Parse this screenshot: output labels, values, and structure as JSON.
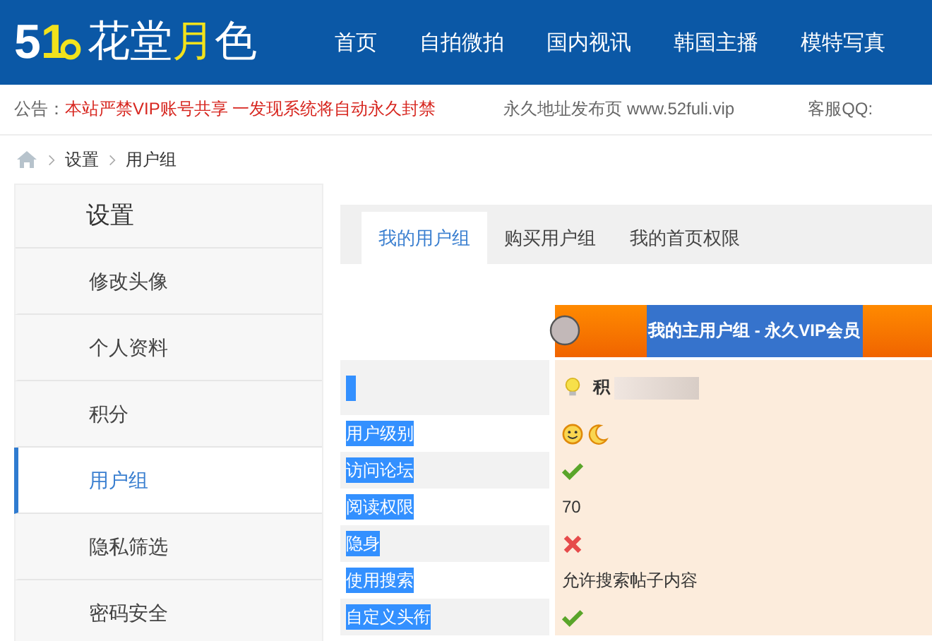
{
  "logo": {
    "parts": [
      {
        "text": "5",
        "accent": false
      },
      {
        "text": "1",
        "accent": true
      },
      {
        "text": "花堂",
        "accent": false
      },
      {
        "text": "月",
        "accent": true
      },
      {
        "text": "色",
        "accent": false
      }
    ]
  },
  "nav": [
    "首页",
    "自拍微拍",
    "国内视讯",
    "韩国主播",
    "模特写真"
  ],
  "notice": {
    "label": "公告：",
    "message": "本站严禁VIP账号共享 一发现系统将自动永久封禁",
    "address": "永久地址发布页 www.52fuli.vip",
    "service": "客服QQ:"
  },
  "breadcrumb": [
    "设置",
    "用户组"
  ],
  "sidebar": {
    "title": "设置",
    "items": [
      {
        "label": "修改头像",
        "selected": false
      },
      {
        "label": "个人资料",
        "selected": false
      },
      {
        "label": "积分",
        "selected": false
      },
      {
        "label": "用户组",
        "selected": true
      },
      {
        "label": "隐私筛选",
        "selected": false
      },
      {
        "label": "密码安全",
        "selected": false
      }
    ]
  },
  "tabs": [
    {
      "label": "我的用户组",
      "selected": true
    },
    {
      "label": "购买用户组",
      "selected": false
    },
    {
      "label": "我的首页权限",
      "selected": false
    }
  ],
  "group_header": "我的主用户组 - 永久VIP会员",
  "rows": [
    {
      "label": "",
      "highlighted": true,
      "kind": "points",
      "value": "积"
    },
    {
      "label": "用户级别",
      "highlighted": true,
      "kind": "level-icons"
    },
    {
      "label": "访问论坛",
      "highlighted": true,
      "kind": "check"
    },
    {
      "label": "阅读权限",
      "highlighted": true,
      "kind": "text",
      "value": "70"
    },
    {
      "label": "隐身",
      "highlighted": true,
      "kind": "cross"
    },
    {
      "label": "使用搜索",
      "highlighted": true,
      "kind": "text",
      "value": "允许搜索帖子内容"
    },
    {
      "label": "自定义头衔",
      "highlighted": true,
      "kind": "check"
    }
  ]
}
